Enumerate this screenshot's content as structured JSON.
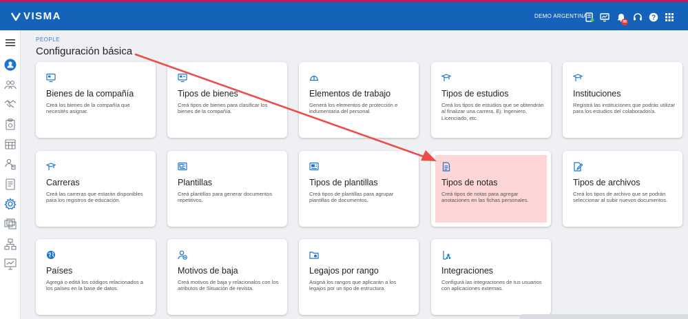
{
  "header": {
    "brand": "VISMA",
    "organization": "DEMO ARGENTINA",
    "notifications_count": "98",
    "icons": [
      "reports-icon",
      "monitor-icon",
      "bell-icon",
      "headset-icon",
      "help-icon",
      "apps-grid-icon"
    ]
  },
  "sidebar": {
    "icons": [
      "menu-icon",
      "user-profile-icon",
      "people-group-icon",
      "handshake-icon",
      "clipboard-icon",
      "calendar-grid-icon",
      "hierarchy-user-icon",
      "document-list-icon",
      "gear-icon",
      "documents-stack-icon",
      "org-chart-icon",
      "presentation-icon"
    ]
  },
  "breadcrumb": "PEOPLE",
  "page_title": "Configuración básica",
  "cards": [
    {
      "title": "Bienes de la compañía",
      "desc": "Creá los bienes de la compañía que necesités asignar.",
      "icon": "asset-monitor-icon"
    },
    {
      "title": "Tipos de bienes",
      "desc": "Creá tipos de bienes para clasificar los bienes de la compañía.",
      "icon": "asset-type-icon"
    },
    {
      "title": "Elementos de trabajo",
      "desc": "Generá los elementos de protección e indumentaria del personal.",
      "icon": "hard-hat-icon"
    },
    {
      "title": "Tipos de estudios",
      "desc": "Creá los tipos de estudios que se obtendrán al finalizar una carrera. Ej: Ingeniero, Licenciado, etc.",
      "icon": "graduation-cap-icon"
    },
    {
      "title": "Instituciones",
      "desc": "Registrá las instituciones que podrás utilizar para los estudios del colaborador/a.",
      "icon": "graduation-cap-icon"
    },
    {
      "title": "Carreras",
      "desc": "Creá las carreras que estarán disponibles para los registros de educación.",
      "icon": "graduation-cap-icon"
    },
    {
      "title": "Plantillas",
      "desc": "Creá plantillas para generar documentos repetitivos.",
      "icon": "template-icon"
    },
    {
      "title": "Tipos de plantillas",
      "desc": "Creá tipos de plantillas para agrupar plantillas de documentos.",
      "icon": "template-type-icon"
    },
    {
      "title": "Tipos de notas",
      "desc": "Creá tipos de notas para agregar anotaciones en las fichas personales.",
      "icon": "note-document-icon"
    },
    {
      "title": "Tipos de archivos",
      "desc": "Creá los tipos de archivo que se podrán seleccionar al subir nuevos documentos.",
      "icon": "file-edit-icon"
    },
    {
      "title": "Países",
      "desc": "Agregá o editá los códigos relacionados a los países en la base de datos.",
      "icon": "globe-icon"
    },
    {
      "title": "Motivos de baja",
      "desc": "Creá motivos de baja y relacionalos con los atributos de Situación de revista.",
      "icon": "user-remove-icon"
    },
    {
      "title": "Legajos por rango",
      "desc": "Asigná los rangos que aplicarán a los legajos por un tipo de estructura.",
      "icon": "folder-range-icon"
    },
    {
      "title": "Integraciones",
      "desc": "Configurá las integraciones de tus usuarios con aplicaciones externas.",
      "icon": "integration-icon"
    }
  ],
  "colors": {
    "header_bg": "#1463b8",
    "accent": "#1b74d1",
    "highlight": "#ffd6d6",
    "arrow": "#ee4b4b"
  }
}
